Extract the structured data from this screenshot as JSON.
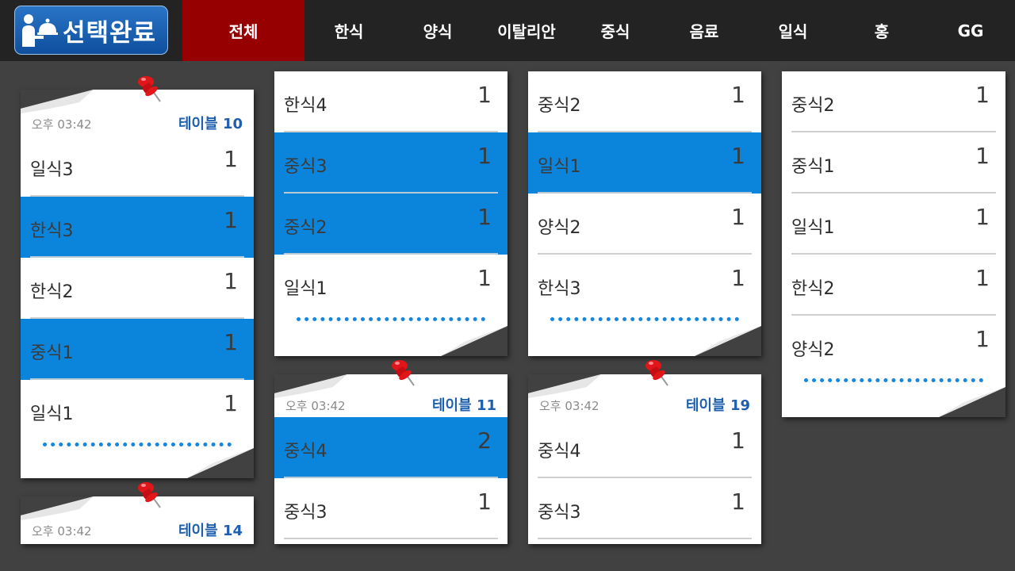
{
  "logo": {
    "text": "선택완료"
  },
  "tabs": [
    {
      "label": "전체",
      "active": true
    },
    {
      "label": "한식",
      "active": false
    },
    {
      "label": "양식",
      "active": false
    },
    {
      "label": "이탈리안",
      "active": false
    },
    {
      "label": "중식",
      "active": false
    },
    {
      "label": "음료",
      "active": false
    },
    {
      "label": "일식",
      "active": false
    },
    {
      "label": "홍",
      "active": false
    },
    {
      "label": "GG",
      "active": false
    }
  ],
  "cards": [
    {
      "time": "오후 03:42",
      "table": "테이블 10",
      "items": [
        {
          "name": "일식3",
          "qty": "1",
          "selected": false
        },
        {
          "name": "한식3",
          "qty": "1",
          "selected": true
        },
        {
          "name": "한식2",
          "qty": "1",
          "selected": false
        },
        {
          "name": "중식1",
          "qty": "1",
          "selected": true
        },
        {
          "name": "일식1",
          "qty": "1",
          "selected": false
        }
      ]
    },
    {
      "time": "오후 03:42",
      "table": "테이블 14",
      "items": []
    },
    {
      "time": "",
      "table": "",
      "items": [
        {
          "name": "한식4",
          "qty": "1",
          "selected": false
        },
        {
          "name": "중식3",
          "qty": "1",
          "selected": true
        },
        {
          "name": "중식2",
          "qty": "1",
          "selected": true
        },
        {
          "name": "일식1",
          "qty": "1",
          "selected": false
        }
      ]
    },
    {
      "time": "오후 03:42",
      "table": "테이블 11",
      "items": [
        {
          "name": "중식4",
          "qty": "2",
          "selected": true
        },
        {
          "name": "중식3",
          "qty": "1",
          "selected": false
        }
      ]
    },
    {
      "time": "",
      "table": "",
      "items": [
        {
          "name": "중식2",
          "qty": "1",
          "selected": false
        },
        {
          "name": "일식1",
          "qty": "1",
          "selected": true
        },
        {
          "name": "양식2",
          "qty": "1",
          "selected": false
        },
        {
          "name": "한식3",
          "qty": "1",
          "selected": false
        }
      ]
    },
    {
      "time": "오후 03:42",
      "table": "테이블 19",
      "items": [
        {
          "name": "중식4",
          "qty": "1",
          "selected": false
        },
        {
          "name": "중식3",
          "qty": "1",
          "selected": false
        }
      ]
    },
    {
      "time": "",
      "table": "",
      "items": [
        {
          "name": "중식2",
          "qty": "1",
          "selected": false
        },
        {
          "name": "중식1",
          "qty": "1",
          "selected": false
        },
        {
          "name": "일식1",
          "qty": "1",
          "selected": false
        },
        {
          "name": "한식2",
          "qty": "1",
          "selected": false
        },
        {
          "name": "양식2",
          "qty": "1",
          "selected": false
        }
      ]
    }
  ],
  "colors": {
    "background": "#414141",
    "topbar": "#232323",
    "active_tab": "#970000",
    "selected_row": "#0b85dc",
    "table_label": "#1f5fb0",
    "pin": "#e0161b"
  }
}
